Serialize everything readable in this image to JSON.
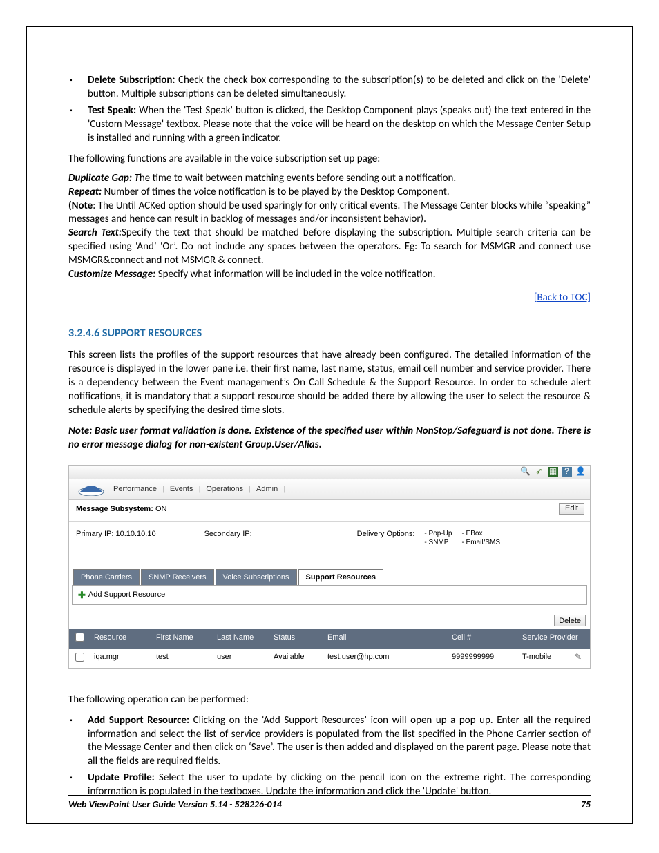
{
  "bullets_top": [
    {
      "label": "Delete Subscription:",
      "text": " Check the check box corresponding to the subscription(s) to be deleted and click on the 'Delete' button. Multiple subscriptions can be deleted simultaneously."
    },
    {
      "label": "Test Speak:",
      "text": " When the 'Test Speak' button is clicked, the Desktop Component plays (speaks out) the text entered in the 'Custom Message' textbox. Please note that the voice will be heard on the desktop on which the Message Center Setup is installed and running with a green indicator."
    }
  ],
  "intro_line": "The following functions are available in the voice subscription set up page:",
  "defs": {
    "dup_label": "Duplicate Gap: ",
    "dup_tchar": "T",
    "dup_text": "he time to wait between matching events before sending out a notification.",
    "rep_label": "Repeat:",
    "rep_text": " Number of times the voice notification is to be played by the Desktop Component.",
    "note_label": "(Note",
    "note_text": ": The Until ACKed option should be used sparingly for only critical events. The Message Center blocks while “speaking” messages and hence can result in backlog of messages and/or inconsistent behavior).",
    "search_label": "Search Text:",
    "search_text": "Specify the text that should be matched before displaying the subscription. Multiple search criteria can be specified using ‘And’ ‘Or’. Do not include any spaces between the operators. Eg: To search for MSMGR and connect use MSMGR&connect and not MSMGR & connect.",
    "cust_label": "Customize Message:",
    "cust_text": " Specify what information will be included in the voice notification."
  },
  "back_link": "[Back to TOC]",
  "section_heading": "3.2.4.6 SUPPORT RESOURCES",
  "section_body": "This screen lists the profiles of the support resources that have already been configured. The detailed information of the resource is displayed in the lower pane i.e. their first name, last name, status, email cell number and service provider. There is a dependency between the Event management’s On Call Schedule & the Support Resource. In order to schedule alert notifications, it is mandatory that a support resource should be added there by allowing the user to select the resource & schedule alerts by specifying the desired time slots.",
  "note_line": "Note: Basic user format validation is done. Existence of the specified user within NonStop/Safeguard is not done. There is no error message dialog for non-existent Group.User/Alias.",
  "app": {
    "menu": [
      "Performance",
      "Events",
      "Operations",
      "Admin"
    ],
    "msg_sub_label": "Message Subsystem: ",
    "msg_sub_val": "ON",
    "edit": "Edit",
    "primary_label": "Primary IP: ",
    "primary_val": "10.10.10.10",
    "secondary_label": "Secondary IP:",
    "deliv_label": "Delivery Options:",
    "deliv_col1": [
      "- Pop-Up",
      "- SNMP"
    ],
    "deliv_col2": [
      "- EBox",
      "- Email/SMS"
    ],
    "subtabs": [
      "Phone Carriers",
      "SNMP Receivers",
      "Voice Subscriptions",
      "Support Resources"
    ],
    "add_label": "Add Support Resource",
    "delete": "Delete",
    "cols": {
      "resource": "Resource",
      "first": "First Name",
      "last": "Last Name",
      "status": "Status",
      "email": "Email",
      "cell": "Cell #",
      "sp": "Service Provider"
    },
    "row": {
      "resource": "iqa.mgr",
      "first": "test",
      "last": "user",
      "status": "Available",
      "email": "test.user@hp.com",
      "cell": "9999999999",
      "sp": "T-mobile"
    }
  },
  "following_op": "The following operation can be performed:",
  "bullets_bottom": [
    {
      "label": "Add Support Resource:",
      "text": " Clicking on the ‘Add Support Resources’ icon will open up a pop up. Enter all the required information and select the list of service providers is populated from the list specified in the Phone Carrier section of the Message Center and then click on ‘Save’. The user is then added and displayed on the parent page. Please note that all the fields are required fields."
    },
    {
      "label": "Update Profile:",
      "text": " Select the user to update by clicking on the pencil icon on the extreme right. The corresponding information is populated in the textboxes. Update the information and click the 'Update' button."
    }
  ],
  "footer_left": "Web ViewPoint User Guide Version 5.14 - 528226-014",
  "footer_right": "75"
}
